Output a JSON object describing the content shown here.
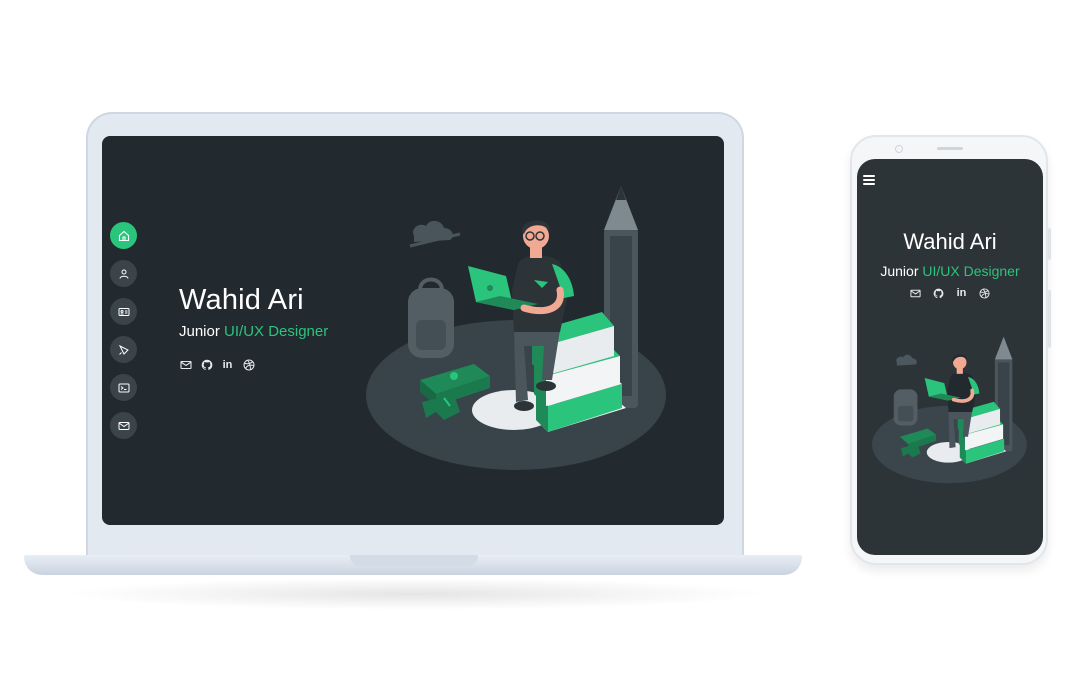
{
  "profile": {
    "name": "Wahid Ari",
    "role_prefix": "Junior",
    "role_highlight": "UI/UX Designer",
    "social": {
      "linkedin_text": "in"
    }
  },
  "nav": {
    "items": [
      {
        "icon": "home-icon",
        "active": true
      },
      {
        "icon": "user-icon",
        "active": false
      },
      {
        "icon": "id-card-icon",
        "active": false
      },
      {
        "icon": "paint-brush-icon",
        "active": false
      },
      {
        "icon": "terminal-icon",
        "active": false
      },
      {
        "icon": "mail-icon",
        "active": false
      }
    ]
  },
  "colors": {
    "accent": "#2bc47c",
    "screen_bg": "#222a30",
    "phone_screen_bg": "#2c3438",
    "nav_bg": "#3a4449"
  }
}
